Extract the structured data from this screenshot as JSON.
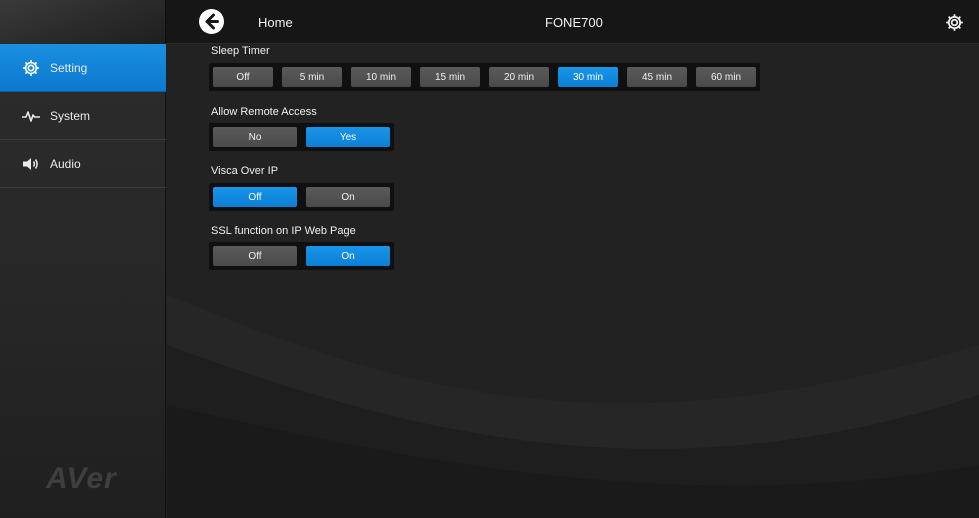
{
  "header": {
    "home_label": "Home",
    "device_title": "FONE700",
    "back_icon": "back-arrow-icon",
    "settings_icon": "gear-icon"
  },
  "sidebar": {
    "items": [
      {
        "label": "Setting",
        "icon": "gear-icon",
        "active": true
      },
      {
        "label": "System",
        "icon": "pulse-icon",
        "active": false
      },
      {
        "label": "Audio",
        "icon": "speaker-icon",
        "active": false
      }
    ],
    "logo": "AVer"
  },
  "settings": {
    "sleep_timer": {
      "label": "Sleep Timer",
      "options": [
        "Off",
        "5 min",
        "10 min",
        "15 min",
        "20 min",
        "30 min",
        "45 min",
        "60 min"
      ],
      "selected": "30 min"
    },
    "remote_access": {
      "label": "Allow Remote Access",
      "options": [
        "No",
        "Yes"
      ],
      "selected": "Yes"
    },
    "visca_over_ip": {
      "label": "Visca Over IP",
      "options": [
        "Off",
        "On"
      ],
      "selected": "Off"
    },
    "ssl_function": {
      "label": "SSL function on IP Web Page",
      "options": [
        "Off",
        "On"
      ],
      "selected": "On"
    }
  },
  "colors": {
    "accent": "#0b7fd6",
    "background": "#222222",
    "button": "#4f4f4f"
  }
}
